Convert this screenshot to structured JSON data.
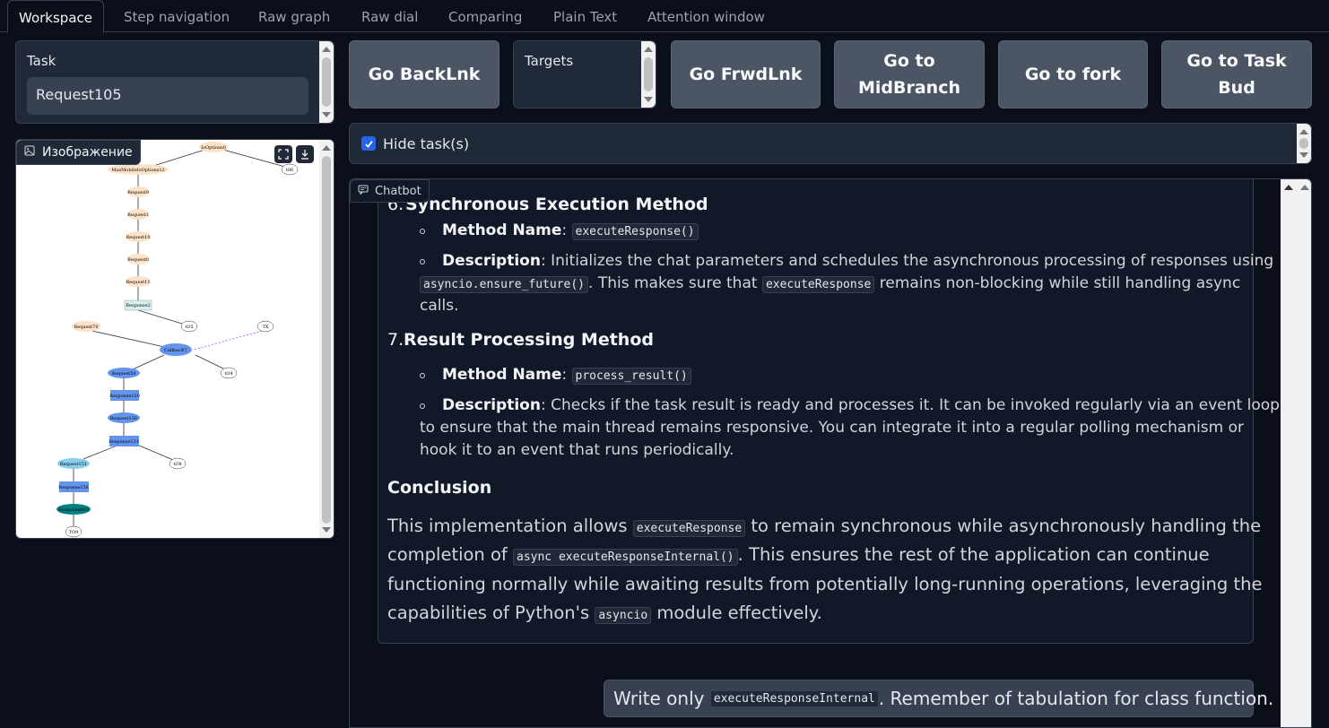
{
  "tabs": [
    "Workspace",
    "Step navigation",
    "Raw graph",
    "Raw dial",
    "Comparing",
    "Plain Text",
    "Attention window"
  ],
  "task": {
    "label": "Task",
    "value": "Request105"
  },
  "image": {
    "label": "Изображение"
  },
  "buttons": {
    "back": "Go BackLnk",
    "targets_label": "Targets",
    "forward": "Go FrwdLnk",
    "mid": "Go to MidBranch",
    "fork": "Go to fork",
    "bud": "Go to Task Bud"
  },
  "hide_tasks": {
    "label": "Hide task(s)",
    "checked": true
  },
  "chatbot": {
    "label": "Chatbot",
    "item6_num": "6.",
    "item6_title": "Synchronous Execution Method",
    "item6_name_label": "Method Name",
    "item6_name_code": "executeResponse()",
    "item6_desc_label": "Description",
    "item6_desc_1": ": Initializes the chat parameters and schedules the asynchronous processing of responses using",
    "item6_desc_code1": "asyncio.ensure_future()",
    "item6_desc_2": ". This makes sure that",
    "item6_desc_code2": "executeResponse",
    "item6_desc_3": "remains non-blocking while still handling async",
    "item6_desc_4": "calls.",
    "item7_num": "7.",
    "item7_title": "Result Processing Method",
    "item7_name_label": "Method Name",
    "item7_name_code": "process_result()",
    "item7_desc_label": "Description",
    "item7_desc_1": ": Checks if the task result is ready and processes it. It can be invoked regularly via an event loop",
    "item7_desc_2": "to ensure that the main thread remains responsive. You can integrate it into a regular polling mechanism or",
    "item7_desc_3": "hook it to an event that runs periodically.",
    "conclusion_title": "Conclusion",
    "conc_1a": "This implementation allows",
    "conc_code1": "executeResponse",
    "conc_1b": "to remain synchronous while asynchronously handling the",
    "conc_2a": "completion of",
    "conc_code2": "async executeResponseInternal()",
    "conc_2b": ". This ensures the rest of the application can continue",
    "conc_3": "functioning normally while awaiting results from potentially long-running operations, leveraging the",
    "conc_4a": "capabilities of Python's",
    "conc_code3": "asyncio",
    "conc_4b": "module effectively.",
    "user_1": "Write only",
    "user_code": "executeResponseInternal",
    "user_2": ". Remember of tabulation for class function."
  },
  "graph_nodes": [
    "IoOptions0",
    "MaxMobileIoOptions12",
    "Request9",
    "Request1",
    "Request10",
    "Request0",
    "Request11",
    "Response2",
    "Request70",
    "tO5",
    "TX",
    "CallbacK7",
    "Request50",
    "tO4",
    "Response120",
    "Request130",
    "Response131",
    "Request151",
    "tO8",
    "Response156",
    "Response603",
    "TO9",
    "t06"
  ],
  "colors": {
    "accent": "#2563eb",
    "node_peach": "#fde2c8",
    "node_blue": "#6495ed",
    "node_teal": "#008080",
    "node_lightblue": "#87ceeb"
  }
}
